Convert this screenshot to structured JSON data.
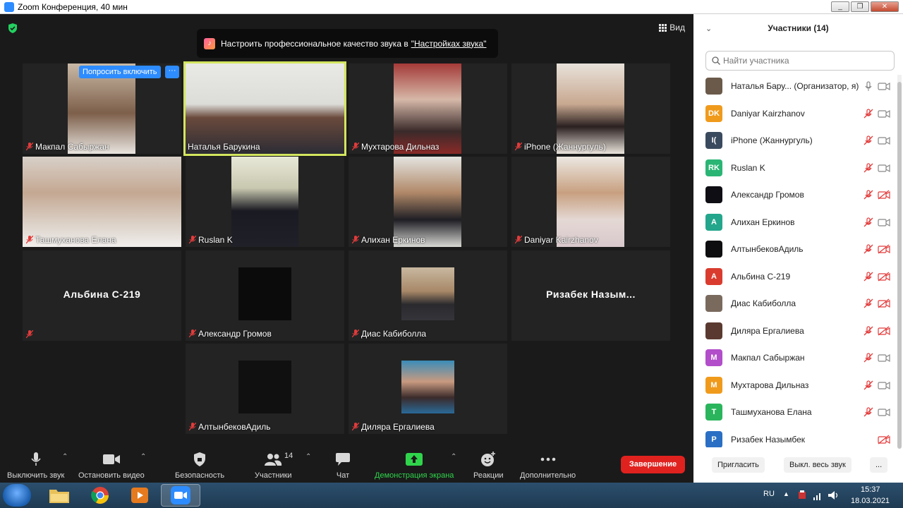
{
  "window": {
    "title": "Zoom Конференция, 40 мин",
    "min": "_",
    "max": "❐",
    "close": "✕"
  },
  "meeting": {
    "view_label": "Вид",
    "banner": {
      "text": "Настроить профессиональное качество звука в ",
      "link": "\"Настройках звука\""
    },
    "ask_button": "Попросить включить",
    "more_button": "···",
    "tiles": [
      {
        "name": "Макпал Сабыржан"
      },
      {
        "name": "Наталья Барукина"
      },
      {
        "name": "Мухтарова Дильназ"
      },
      {
        "name": "iPhone (Жаннургуль)"
      },
      {
        "name": "Ташмуханова Елана"
      },
      {
        "name": "Ruslan K"
      },
      {
        "name": "Алихан Еркинов"
      },
      {
        "name": "Daniyar Kairzhanov"
      },
      {
        "name": "Альбина С-219",
        "big": "Альбина С-219"
      },
      {
        "name": "Александр Громов"
      },
      {
        "name": "Диас Кабиболла"
      },
      {
        "name": "Ризабек Назым...",
        "big": "Ризабек  Назым..."
      },
      {
        "name": "АлтынбековАдиль"
      },
      {
        "name": "Диляра Ергалиева"
      }
    ]
  },
  "toolbar": {
    "mute": "Выключить звук",
    "video": "Остановить видео",
    "security": "Безопасность",
    "participants": "Участники",
    "participants_count": "14",
    "chat": "Чат",
    "share": "Демонстрация экрана",
    "reactions": "Реакции",
    "more": "Дополнительно",
    "end": "Завершение"
  },
  "panel": {
    "title": "Участники (14)",
    "search_placeholder": "Найти участника",
    "participants": [
      {
        "name": "Наталья Бару...  (Организатор, я)",
        "initials": "",
        "color": "#6b5a4a"
      },
      {
        "name": "Daniyar Kairzhanov",
        "initials": "DK",
        "color": "#f09a1c"
      },
      {
        "name": "iPhone (Жаннургуль)",
        "initials": "I(",
        "color": "#3a4a5e"
      },
      {
        "name": "Ruslan K",
        "initials": "RK",
        "color": "#2ab574"
      },
      {
        "name": "Александр Громов",
        "initials": "",
        "color": "#0e0e14"
      },
      {
        "name": "Алихан Еркинов",
        "initials": "A",
        "color": "#23a68c"
      },
      {
        "name": "АлтынбековАдиль",
        "initials": "",
        "color": "#0e0e10"
      },
      {
        "name": "Альбина С-219",
        "initials": "A",
        "color": "#d93c2e"
      },
      {
        "name": "Диас Кабиболла",
        "initials": "",
        "color": "#7a6a5e"
      },
      {
        "name": "Диляра Ергалиева",
        "initials": "",
        "color": "#5a3a30"
      },
      {
        "name": "Макпал Сабыржан",
        "initials": "M",
        "color": "#b24ec9"
      },
      {
        "name": "Мухтарова Дильназ",
        "initials": "M",
        "color": "#f09a1c"
      },
      {
        "name": "Ташмуханова Елана",
        "initials": "T",
        "color": "#2ab55c"
      },
      {
        "name": "Ризабек Назымбек",
        "initials": "P",
        "color": "#2a6fc4"
      }
    ],
    "invite": "Пригласить",
    "mute_all": "Выкл. весь звук",
    "more": "..."
  },
  "taskbar": {
    "lang": "RU",
    "time": "15:37",
    "date": "18.03.2021"
  }
}
